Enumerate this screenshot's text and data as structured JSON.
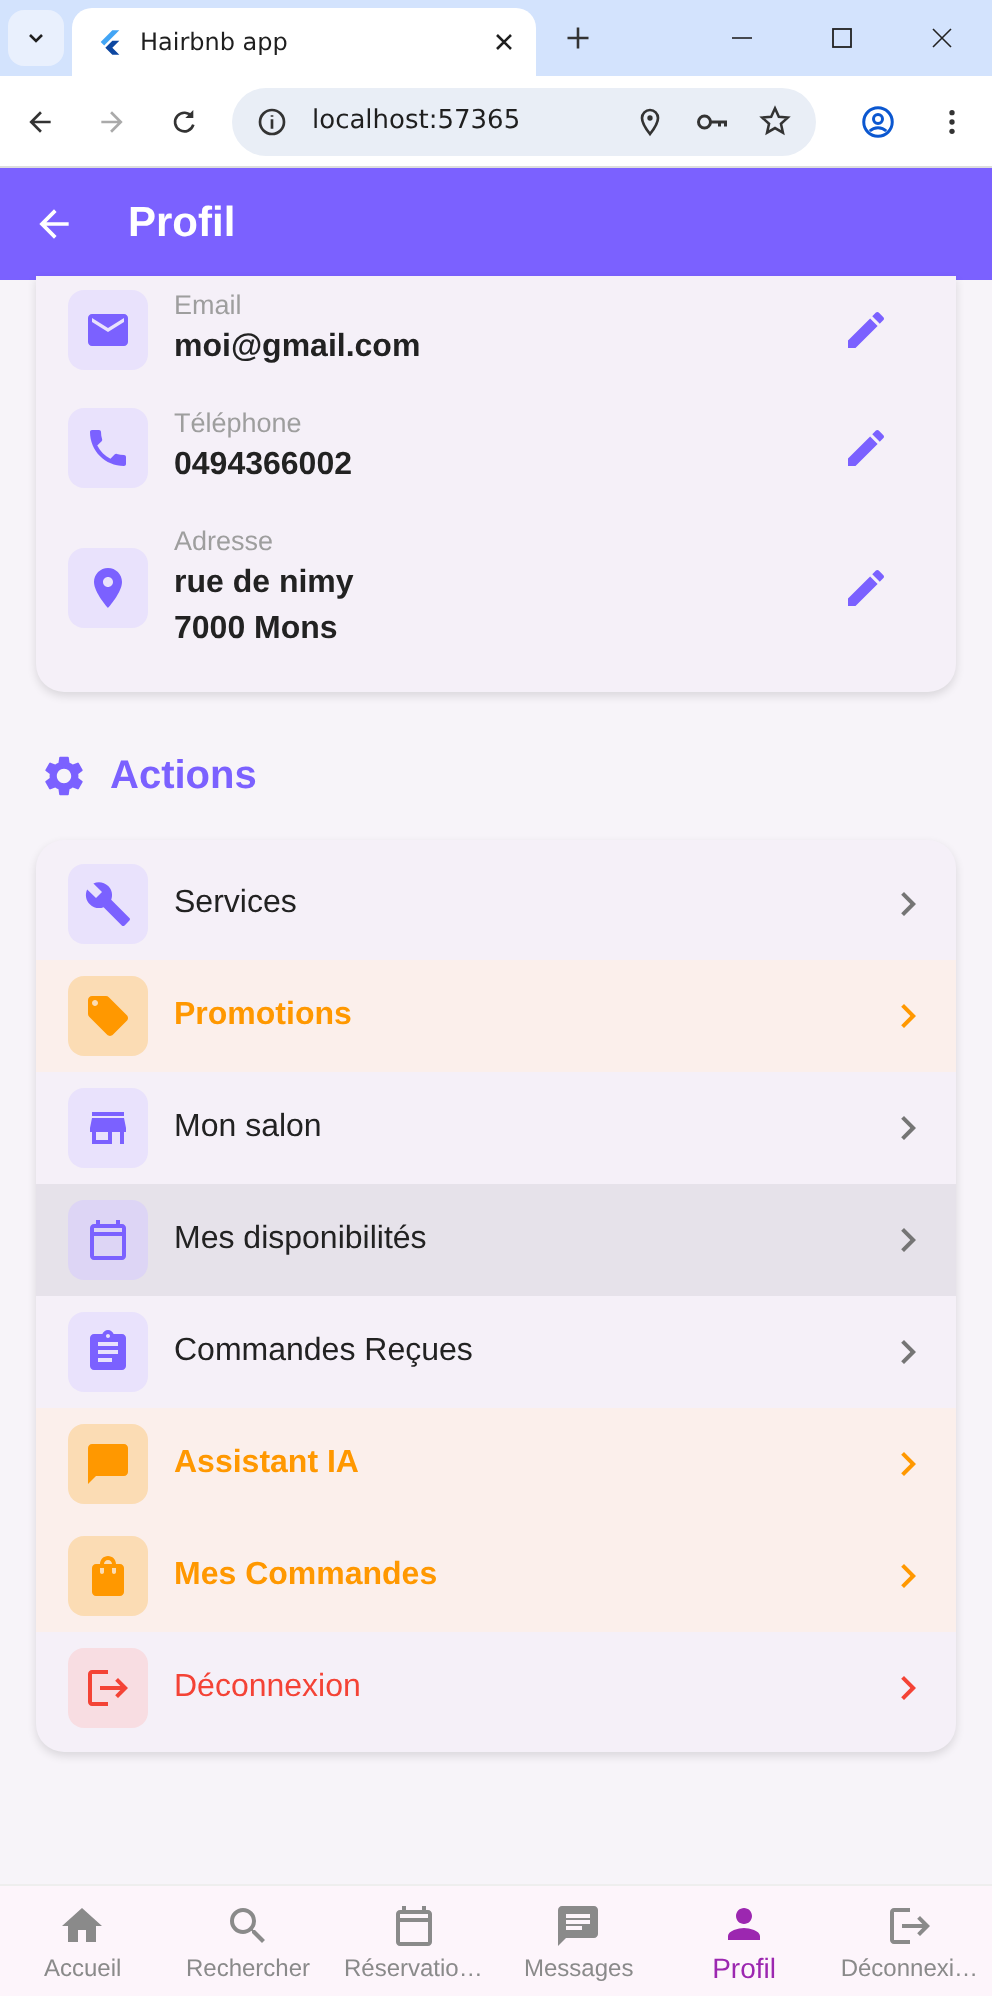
{
  "browser": {
    "tab_title": "Hairbnb app",
    "url": "localhost:57365"
  },
  "app_bar": {
    "title": "Profil"
  },
  "contact": [
    {
      "label": "Email",
      "lines": [
        "moi@gmail.com"
      ]
    },
    {
      "label": "Téléphone",
      "lines": [
        "0494366002"
      ]
    },
    {
      "label": "Adresse",
      "lines": [
        "rue de nimy",
        "7000 Mons"
      ]
    }
  ],
  "actions_title": "Actions",
  "actions": [
    {
      "label": "Services",
      "kind": "normal",
      "selected": false
    },
    {
      "label": "Promotions",
      "kind": "highlight",
      "selected": false
    },
    {
      "label": "Mon salon",
      "kind": "normal",
      "selected": false
    },
    {
      "label": "Mes disponibilités",
      "kind": "normal",
      "selected": true
    },
    {
      "label": "Commandes Reçues",
      "kind": "normal",
      "selected": false
    },
    {
      "label": "Assistant IA",
      "kind": "highlight",
      "selected": false
    },
    {
      "label": "Mes Commandes",
      "kind": "highlight",
      "selected": false
    },
    {
      "label": "Déconnexion",
      "kind": "danger",
      "selected": false
    }
  ],
  "bottom_nav": [
    {
      "label": "Accueil",
      "selected": false
    },
    {
      "label": "Rechercher",
      "selected": false
    },
    {
      "label": "Réservatio…",
      "selected": false
    },
    {
      "label": "Messages",
      "selected": false
    },
    {
      "label": "Profil",
      "selected": true
    },
    {
      "label": "Déconnexi…",
      "selected": false
    }
  ]
}
